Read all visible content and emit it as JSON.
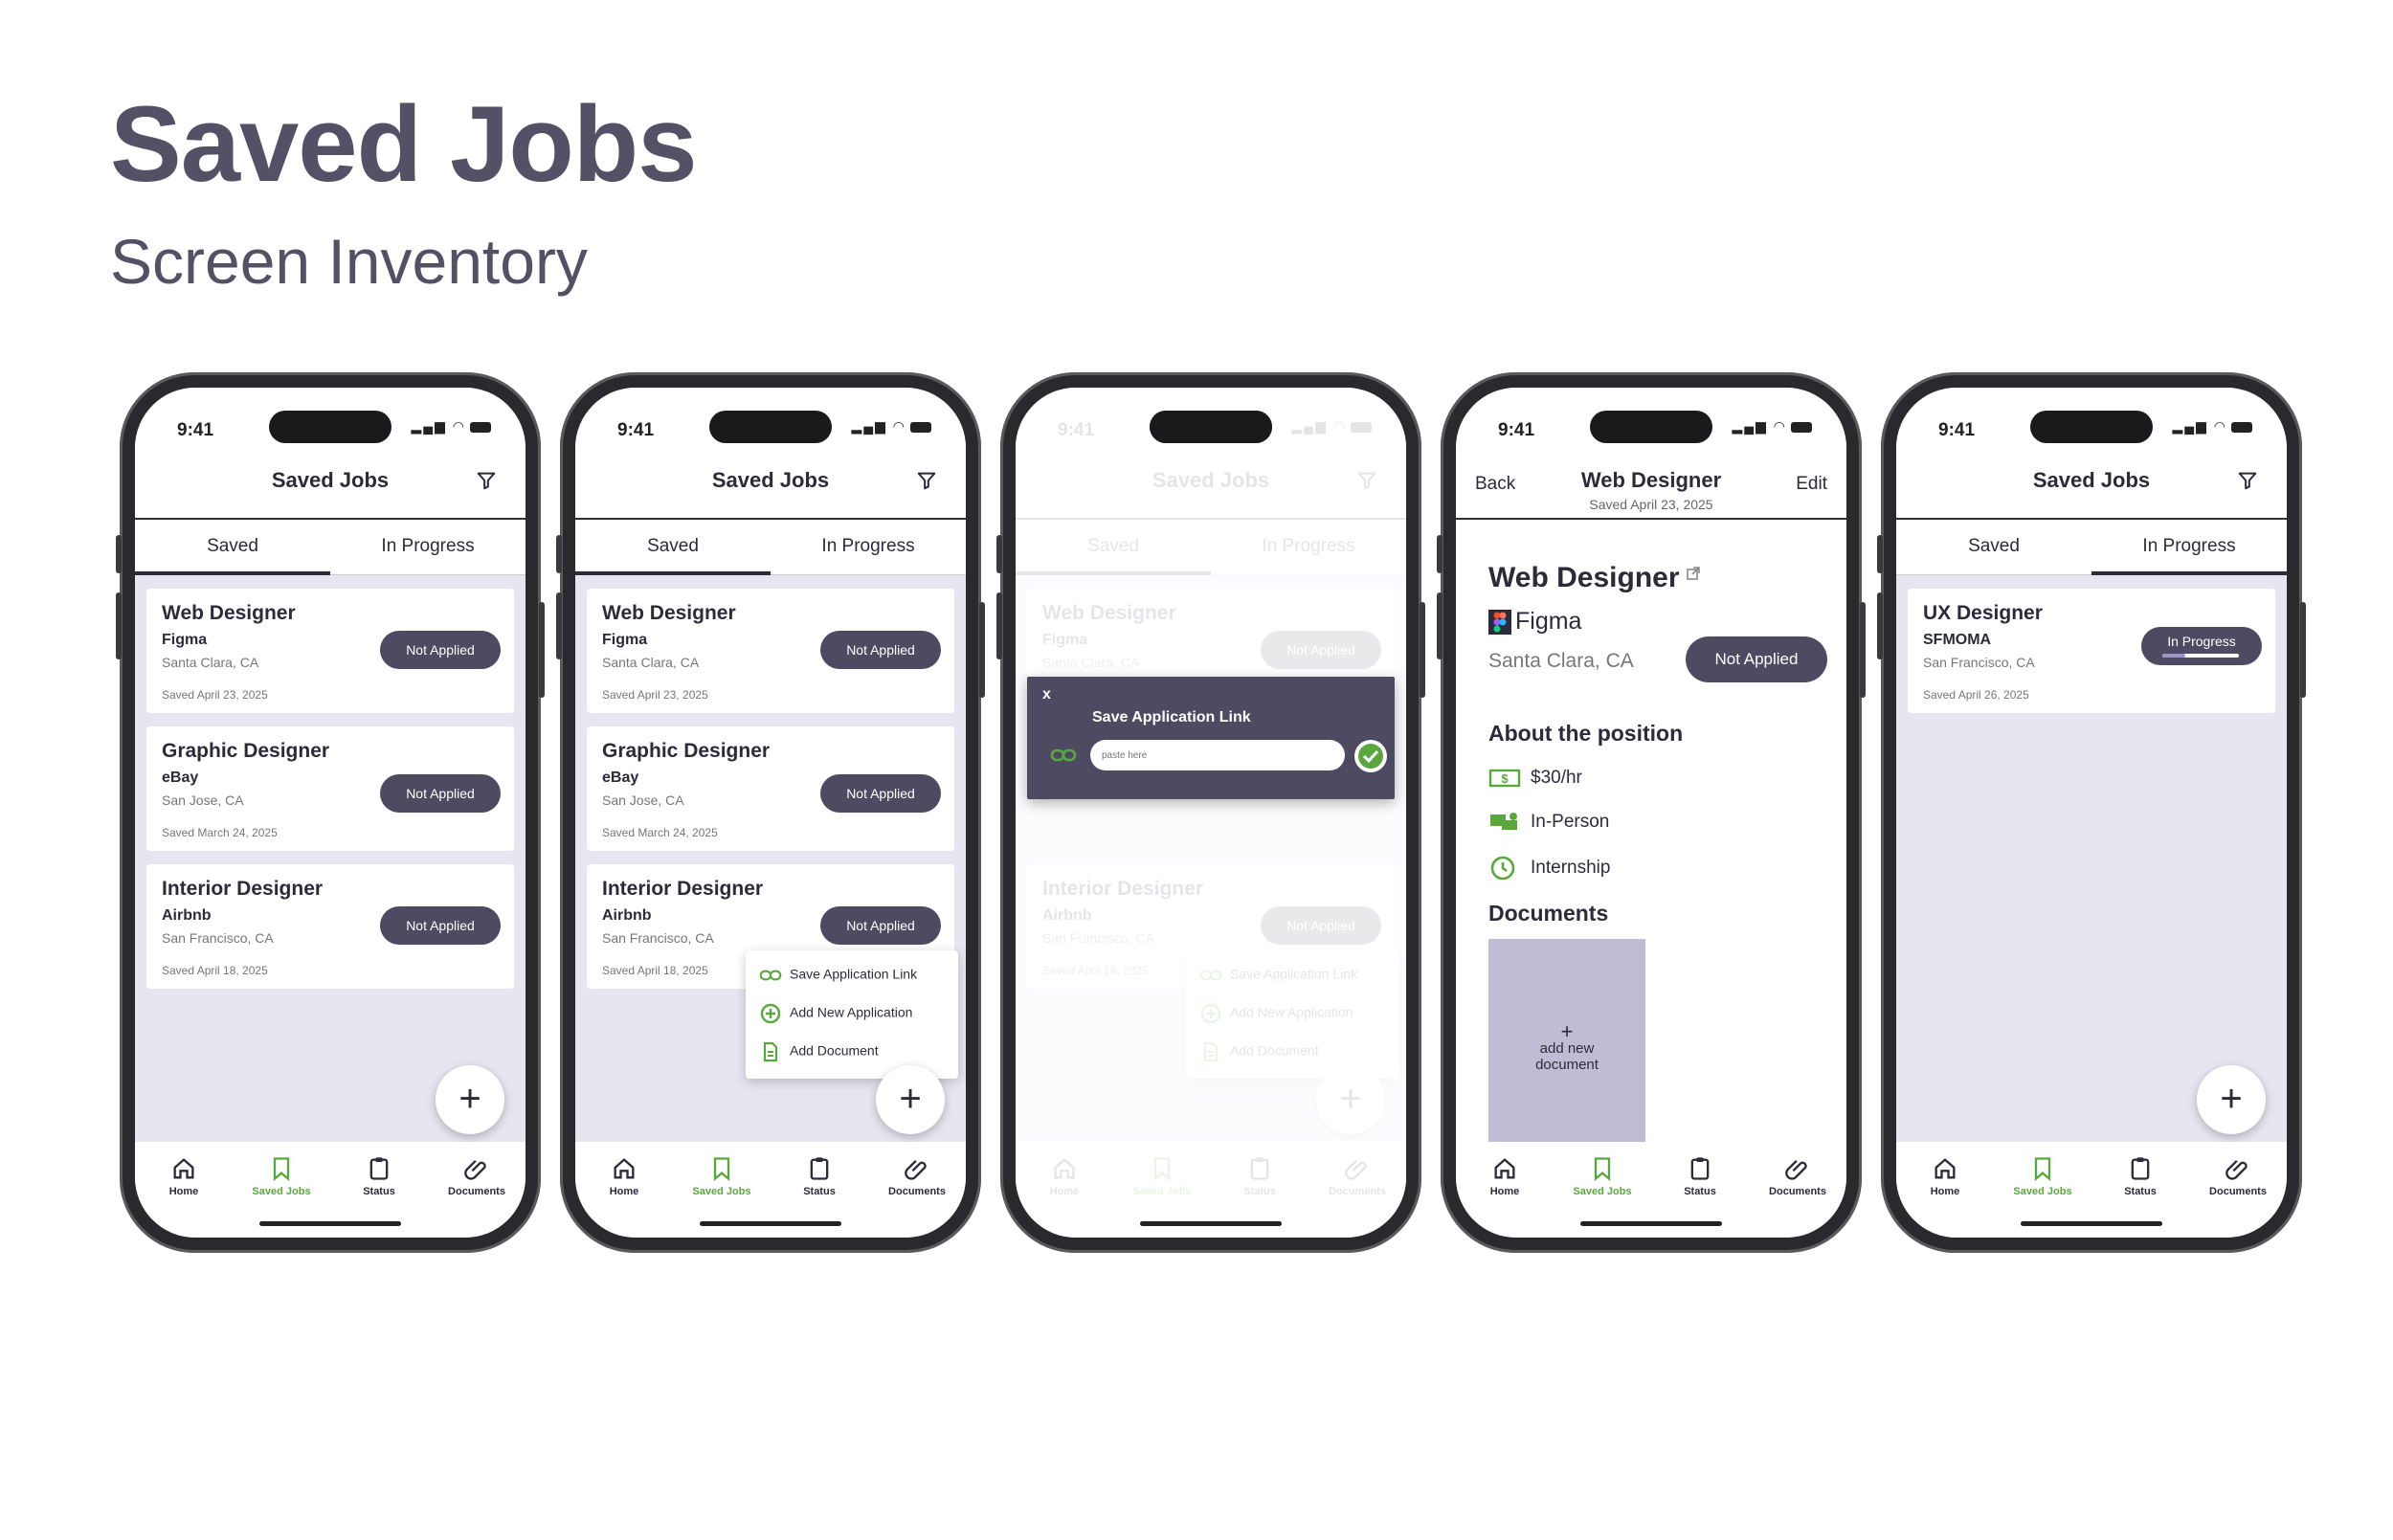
{
  "header": {
    "title": "Saved Jobs",
    "subtitle": "Screen Inventory"
  },
  "common": {
    "time": "9:41",
    "screen_title": "Saved Jobs",
    "tab_saved": "Saved",
    "tab_in_progress": "In Progress",
    "fab_label": "+",
    "nav": {
      "home": "Home",
      "saved_jobs": "Saved Jobs",
      "status": "Status",
      "documents": "Documents"
    },
    "colors": {
      "accent_green": "#5aa83d",
      "pill_dark": "#4d4a61",
      "background": "#e7e6f0",
      "doc_tile": "#c1bcd6"
    }
  },
  "jobs": [
    {
      "title": "Web Designer",
      "company": "Figma",
      "location": "Santa Clara, CA",
      "saved": "Saved April 23, 2025",
      "status": "Not Applied"
    },
    {
      "title": "Graphic Designer",
      "company": "eBay",
      "location": "San Jose, CA",
      "saved": "Saved March 24, 2025",
      "status": "Not Applied"
    },
    {
      "title": "Interior Designer",
      "company": "Airbnb",
      "location": "San Francisco, CA",
      "saved": "Saved April 18, 2025",
      "status": "Not Applied"
    }
  ],
  "menu": {
    "save_link": "Save Application Link",
    "add_application": "Add New Application",
    "add_document": "Add Document"
  },
  "dialog": {
    "close": "x",
    "title": "Save Application Link",
    "placeholder": "paste here"
  },
  "detail": {
    "back": "Back",
    "edit": "Edit",
    "nav_title": "Web Designer",
    "saved_sub": "Saved April 23, 2025",
    "title": "Web Designer",
    "company": "Figma",
    "location": "Santa Clara, CA",
    "status": "Not Applied",
    "about_heading": "About the position",
    "pay": "$30/hr",
    "mode": "In-Person",
    "type": "Internship",
    "documents_heading": "Documents",
    "add_doc_plus": "+",
    "add_doc_label": "add new document"
  },
  "in_progress_job": {
    "title": "UX Designer",
    "company": "SFMOMA",
    "location": "San Francisco, CA",
    "saved": "Saved April 26, 2025",
    "status": "In Progress",
    "progress": 0.3
  }
}
